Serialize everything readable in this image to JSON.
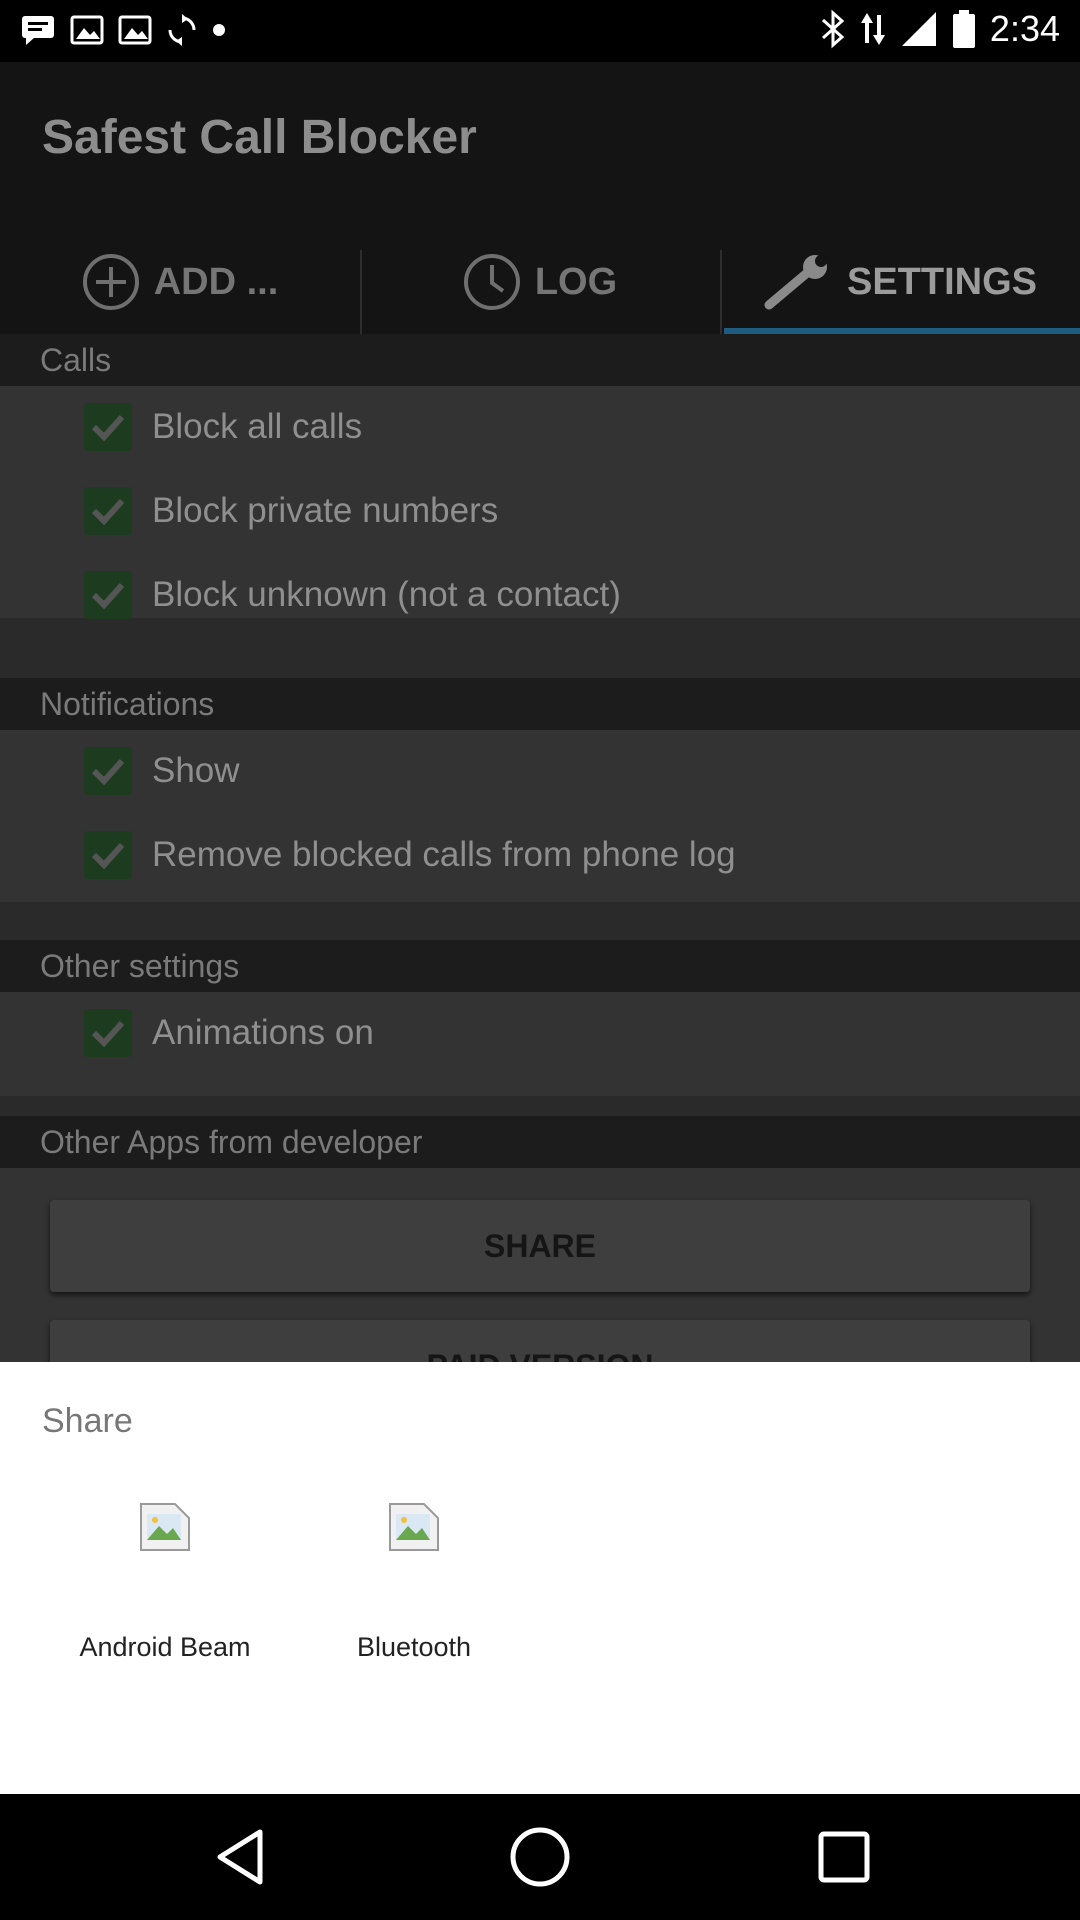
{
  "status_bar": {
    "time": "2:34",
    "left_icons": [
      "message-icon",
      "image-icon",
      "image-icon",
      "sync-icon",
      "dot-icon"
    ],
    "right_icons": [
      "bluetooth-icon",
      "data-icon",
      "signal-icon",
      "battery-icon"
    ]
  },
  "app": {
    "title": "Safest Call Blocker",
    "tabs": [
      {
        "label": "ADD ...",
        "icon": "add-circle-icon"
      },
      {
        "label": "LOG",
        "icon": "clock-icon"
      },
      {
        "label": "SETTINGS",
        "icon": "wrench-icon",
        "active": true
      }
    ]
  },
  "sections": {
    "calls": {
      "header": "Calls",
      "items": [
        "Block all calls",
        "Block private numbers",
        "Block unknown (not a contact)"
      ]
    },
    "notifications": {
      "header": "Notifications",
      "items": [
        "Show",
        "Remove blocked calls from phone log"
      ]
    },
    "other_settings": {
      "header": "Other settings",
      "items": [
        "Animations on"
      ]
    },
    "other_apps": {
      "header": "Other Apps from developer",
      "share_button": "SHARE",
      "paid_button": "PAID VERSION"
    }
  },
  "share_sheet": {
    "title": "Share",
    "targets": [
      {
        "label": "Android Beam",
        "icon": "broken-image-icon"
      },
      {
        "label": "Bluetooth",
        "icon": "broken-image-icon"
      }
    ]
  },
  "nav_bar": {
    "buttons": [
      "back-icon",
      "home-icon",
      "recents-icon"
    ]
  },
  "colors": {
    "checkbox_accent": "#1d3b1e",
    "tab_indicator": "#1f5c80",
    "sheet_background": "#ffffff"
  }
}
